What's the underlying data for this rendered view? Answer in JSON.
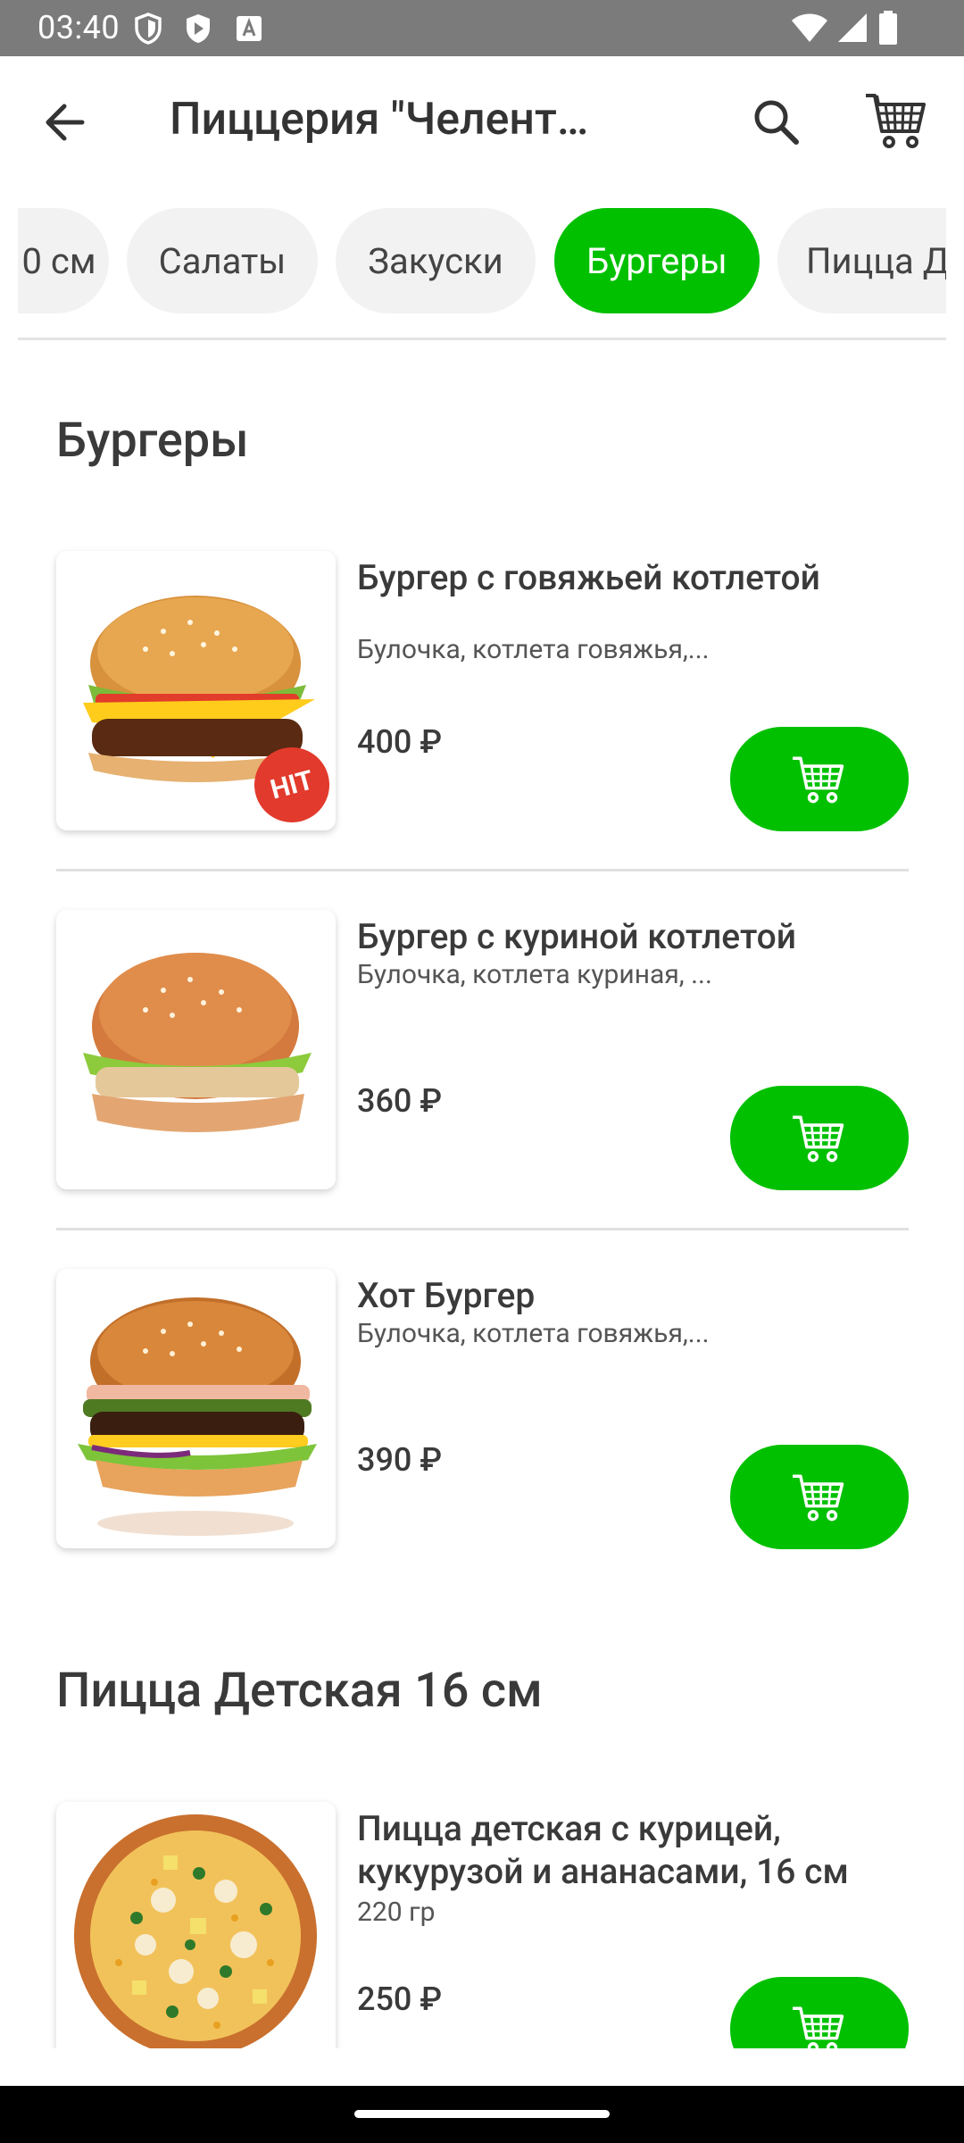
{
  "status_bar": {
    "time": "03:40"
  },
  "app_bar": {
    "title": "Пиццерия \"Челент…"
  },
  "categories": [
    {
      "label": "0 см",
      "active": false
    },
    {
      "label": "Салаты",
      "active": false
    },
    {
      "label": "Закуски",
      "active": false
    },
    {
      "label": "Бургеры",
      "active": true
    },
    {
      "label": "Пицца Д",
      "active": false
    }
  ],
  "sections": [
    {
      "title": "Бургеры",
      "items": [
        {
          "name": "Бургер с говяжьей котлетой",
          "description": "Булочка, котлета говяжья,...",
          "price": "400 ₽",
          "badge": "HIT"
        },
        {
          "name": "Бургер с куриной котлетой",
          "description": "Булочка, котлета куриная, ...",
          "price": "360 ₽"
        },
        {
          "name": "Хот Бургер",
          "description": "Булочка, котлета говяжья,...",
          "price": "390 ₽"
        }
      ]
    },
    {
      "title": "Пицца Детская 16 см",
      "items": [
        {
          "name": "Пицца детская с курицей, кукурузой и ананасами, 16 см",
          "description": "220 гр",
          "price": "250 ₽"
        }
      ]
    }
  ],
  "colors": {
    "accent": "#00c000",
    "badge": "#e23a2c"
  }
}
